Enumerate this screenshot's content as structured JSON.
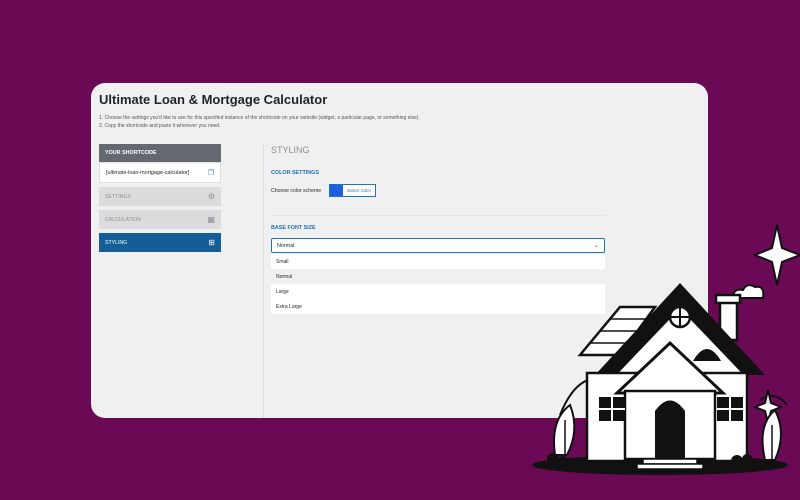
{
  "title": "Ultimate Loan & Mortgage Calculator",
  "instructions": [
    "1. Choose the settings you'd like to use for this specified instance of the shortcode on your website (widget, a particular page, or something else).",
    "2. Copy the shortcode and paste it wherever you need."
  ],
  "sidebar": {
    "shortcode_header": "YOUR SHORTCODE",
    "shortcode_value": "[ultimate-loan-mortgage-calculator]",
    "items": [
      {
        "label": "SETTINGS",
        "icon": "gear-icon"
      },
      {
        "label": "CALCULATION",
        "icon": "calculator-icon"
      },
      {
        "label": "STYLING",
        "icon": "grid-icon"
      }
    ]
  },
  "main": {
    "section_title": "STYLING",
    "color_settings": {
      "title": "COLOR SETTINGS",
      "label": "Choose color scheme",
      "button_label": "Select Color",
      "swatch_color": "#1d5fe0"
    },
    "font_size": {
      "title": "BASE FONT SIZE",
      "selected": "Normal",
      "options": [
        "Small",
        "Normal",
        "Large",
        "Extra Large"
      ]
    }
  },
  "colors": {
    "background": "#6a0a55",
    "accent": "#135e96",
    "link": "#2271b1"
  }
}
